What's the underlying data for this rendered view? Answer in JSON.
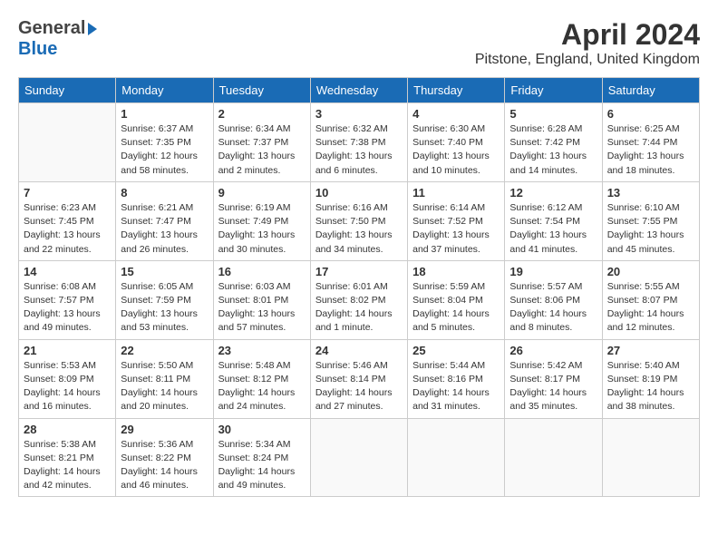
{
  "header": {
    "logo_general": "General",
    "logo_blue": "Blue",
    "month_title": "April 2024",
    "location": "Pitstone, England, United Kingdom"
  },
  "weekdays": [
    "Sunday",
    "Monday",
    "Tuesday",
    "Wednesday",
    "Thursday",
    "Friday",
    "Saturday"
  ],
  "weeks": [
    [
      {
        "day": "",
        "info": ""
      },
      {
        "day": "1",
        "info": "Sunrise: 6:37 AM\nSunset: 7:35 PM\nDaylight: 12 hours\nand 58 minutes."
      },
      {
        "day": "2",
        "info": "Sunrise: 6:34 AM\nSunset: 7:37 PM\nDaylight: 13 hours\nand 2 minutes."
      },
      {
        "day": "3",
        "info": "Sunrise: 6:32 AM\nSunset: 7:38 PM\nDaylight: 13 hours\nand 6 minutes."
      },
      {
        "day": "4",
        "info": "Sunrise: 6:30 AM\nSunset: 7:40 PM\nDaylight: 13 hours\nand 10 minutes."
      },
      {
        "day": "5",
        "info": "Sunrise: 6:28 AM\nSunset: 7:42 PM\nDaylight: 13 hours\nand 14 minutes."
      },
      {
        "day": "6",
        "info": "Sunrise: 6:25 AM\nSunset: 7:44 PM\nDaylight: 13 hours\nand 18 minutes."
      }
    ],
    [
      {
        "day": "7",
        "info": "Sunrise: 6:23 AM\nSunset: 7:45 PM\nDaylight: 13 hours\nand 22 minutes."
      },
      {
        "day": "8",
        "info": "Sunrise: 6:21 AM\nSunset: 7:47 PM\nDaylight: 13 hours\nand 26 minutes."
      },
      {
        "day": "9",
        "info": "Sunrise: 6:19 AM\nSunset: 7:49 PM\nDaylight: 13 hours\nand 30 minutes."
      },
      {
        "day": "10",
        "info": "Sunrise: 6:16 AM\nSunset: 7:50 PM\nDaylight: 13 hours\nand 34 minutes."
      },
      {
        "day": "11",
        "info": "Sunrise: 6:14 AM\nSunset: 7:52 PM\nDaylight: 13 hours\nand 37 minutes."
      },
      {
        "day": "12",
        "info": "Sunrise: 6:12 AM\nSunset: 7:54 PM\nDaylight: 13 hours\nand 41 minutes."
      },
      {
        "day": "13",
        "info": "Sunrise: 6:10 AM\nSunset: 7:55 PM\nDaylight: 13 hours\nand 45 minutes."
      }
    ],
    [
      {
        "day": "14",
        "info": "Sunrise: 6:08 AM\nSunset: 7:57 PM\nDaylight: 13 hours\nand 49 minutes."
      },
      {
        "day": "15",
        "info": "Sunrise: 6:05 AM\nSunset: 7:59 PM\nDaylight: 13 hours\nand 53 minutes."
      },
      {
        "day": "16",
        "info": "Sunrise: 6:03 AM\nSunset: 8:01 PM\nDaylight: 13 hours\nand 57 minutes."
      },
      {
        "day": "17",
        "info": "Sunrise: 6:01 AM\nSunset: 8:02 PM\nDaylight: 14 hours\nand 1 minute."
      },
      {
        "day": "18",
        "info": "Sunrise: 5:59 AM\nSunset: 8:04 PM\nDaylight: 14 hours\nand 5 minutes."
      },
      {
        "day": "19",
        "info": "Sunrise: 5:57 AM\nSunset: 8:06 PM\nDaylight: 14 hours\nand 8 minutes."
      },
      {
        "day": "20",
        "info": "Sunrise: 5:55 AM\nSunset: 8:07 PM\nDaylight: 14 hours\nand 12 minutes."
      }
    ],
    [
      {
        "day": "21",
        "info": "Sunrise: 5:53 AM\nSunset: 8:09 PM\nDaylight: 14 hours\nand 16 minutes."
      },
      {
        "day": "22",
        "info": "Sunrise: 5:50 AM\nSunset: 8:11 PM\nDaylight: 14 hours\nand 20 minutes."
      },
      {
        "day": "23",
        "info": "Sunrise: 5:48 AM\nSunset: 8:12 PM\nDaylight: 14 hours\nand 24 minutes."
      },
      {
        "day": "24",
        "info": "Sunrise: 5:46 AM\nSunset: 8:14 PM\nDaylight: 14 hours\nand 27 minutes."
      },
      {
        "day": "25",
        "info": "Sunrise: 5:44 AM\nSunset: 8:16 PM\nDaylight: 14 hours\nand 31 minutes."
      },
      {
        "day": "26",
        "info": "Sunrise: 5:42 AM\nSunset: 8:17 PM\nDaylight: 14 hours\nand 35 minutes."
      },
      {
        "day": "27",
        "info": "Sunrise: 5:40 AM\nSunset: 8:19 PM\nDaylight: 14 hours\nand 38 minutes."
      }
    ],
    [
      {
        "day": "28",
        "info": "Sunrise: 5:38 AM\nSunset: 8:21 PM\nDaylight: 14 hours\nand 42 minutes."
      },
      {
        "day": "29",
        "info": "Sunrise: 5:36 AM\nSunset: 8:22 PM\nDaylight: 14 hours\nand 46 minutes."
      },
      {
        "day": "30",
        "info": "Sunrise: 5:34 AM\nSunset: 8:24 PM\nDaylight: 14 hours\nand 49 minutes."
      },
      {
        "day": "",
        "info": ""
      },
      {
        "day": "",
        "info": ""
      },
      {
        "day": "",
        "info": ""
      },
      {
        "day": "",
        "info": ""
      }
    ]
  ]
}
